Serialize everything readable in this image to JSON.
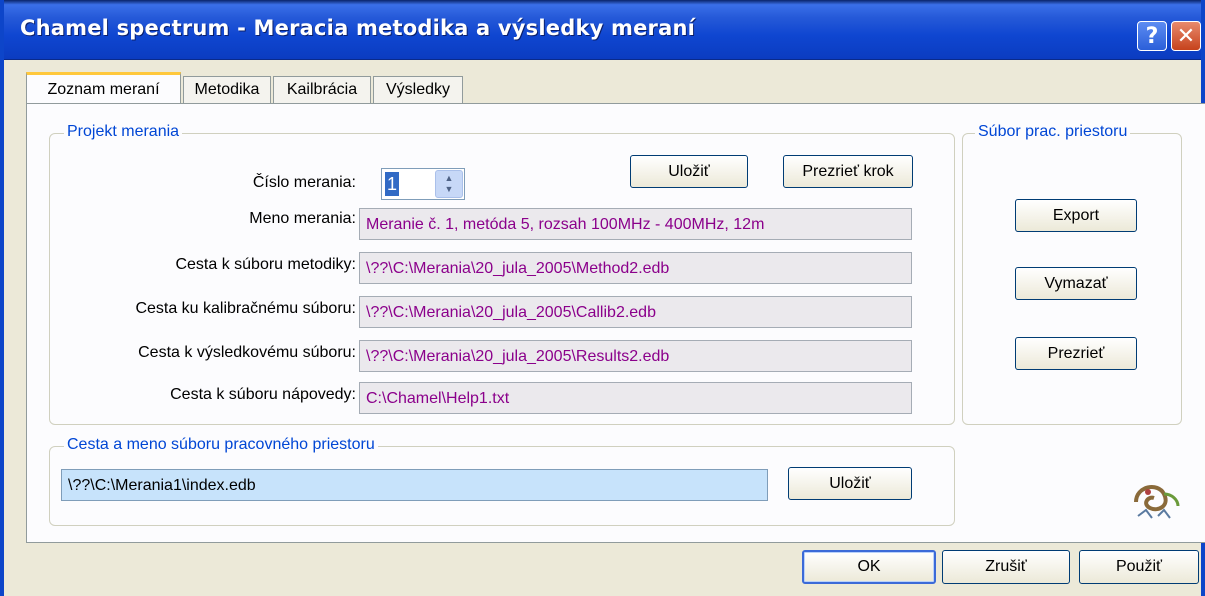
{
  "window": {
    "title": "Chamel spectrum - Meracia metodika a výsledky meraní",
    "help_label": "?",
    "close_label": "✕"
  },
  "tabs": [
    {
      "label": "Zoznam meraní",
      "active": true
    },
    {
      "label": "Metodika",
      "active": false
    },
    {
      "label": "Kailbrácia",
      "active": false
    },
    {
      "label": "Výsledky",
      "active": false
    }
  ],
  "project": {
    "title": "Projekt merania",
    "number_label": "Číslo merania:",
    "number_value": "1",
    "save_label": "Uložiť",
    "review_step_label": "Prezrieť krok",
    "fields": [
      {
        "label": "Meno merania:",
        "value": "Meranie č. 1, metóda 5, rozsah 100MHz - 400MHz, 12m"
      },
      {
        "label": "Cesta k súboru metodiky:",
        "value": "\\??\\C:\\Merania\\20_jula_2005\\Method2.edb"
      },
      {
        "label": "Cesta ku kalibračnému súboru:",
        "value": "\\??\\C:\\Merania\\20_jula_2005\\Callib2.edb"
      },
      {
        "label": "Cesta k výsledkovému súboru:",
        "value": "\\??\\C:\\Merania\\20_jula_2005\\Results2.edb"
      },
      {
        "label": "Cesta k súboru nápovedy:",
        "value": "C:\\Chamel\\Help1.txt"
      }
    ]
  },
  "workspace": {
    "title": "Súbor prac. priestoru",
    "export_label": "Export",
    "delete_label": "Vymazať",
    "view_label": "Prezrieť"
  },
  "workspace_path": {
    "title": "Cesta a meno súboru pracovného priestoru",
    "value": "\\??\\C:\\Merania1\\index.edb",
    "save_label": "Uložiť"
  },
  "footer": {
    "ok_label": "OK",
    "cancel_label": "Zrušiť",
    "apply_label": "Použiť"
  }
}
